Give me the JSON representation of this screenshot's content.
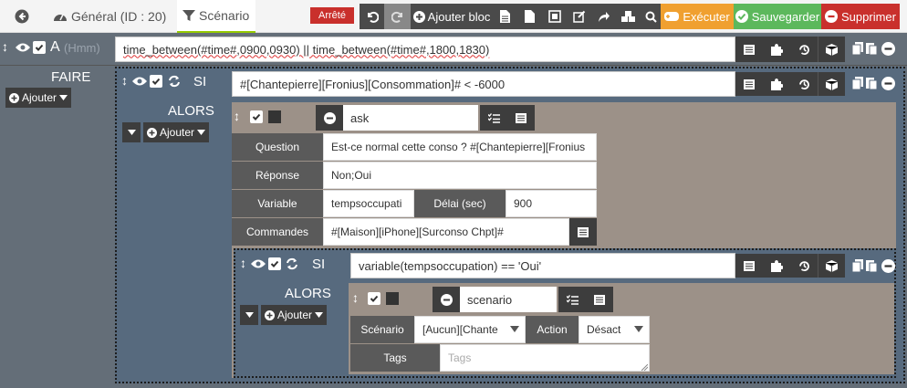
{
  "nav": {
    "general_label": "Général (ID : 20)",
    "scenario_label": "Scénario",
    "status": "Arrêté",
    "add_block_label": "Ajouter bloc",
    "execute_label": "Exécuter",
    "save_label": "Sauvegarder",
    "delete_label": "Supprimer"
  },
  "colors": {
    "status_red": "#c9302c",
    "execute_orange": "#f0a030",
    "save_green": "#5cb85c",
    "delete_red": "#c9302c",
    "main_bg": "#646e78",
    "block_bg": "#9c9188",
    "nested_bg": "#576a7e"
  },
  "block_a": {
    "letter": "A",
    "hint": "(Hmm)",
    "condition": "time_between(#time#,0900,0930) || time_between(#time#,1800,1830)",
    "faire_label": "FAIRE",
    "add_label": "Ajouter"
  },
  "si_block": {
    "si_label": "SI",
    "condition": "#[Chantepierre][Fronius][Consommation]# < -6000",
    "alors_label": "ALORS",
    "add_label": "Ajouter"
  },
  "ask_action": {
    "name": "ask",
    "question_label": "Question",
    "question_value": "Est-ce normal cette conso ? #[Chantepierre][Fronius",
    "reponse_label": "Réponse",
    "reponse_value": "Non;Oui",
    "variable_label": "Variable",
    "variable_value": "tempsoccupati",
    "delai_label": "Délai (sec)",
    "delai_value": "900",
    "commandes_label": "Commandes",
    "commandes_value": "#[Maison][iPhone][Surconso Chpt]#"
  },
  "si_block_2": {
    "si_label": "SI",
    "condition": "variable(tempsoccupation) == 'Oui'",
    "alors_label": "ALORS",
    "add_label": "Ajouter"
  },
  "scenario_action": {
    "name": "scenario",
    "scenario_label": "Scénario",
    "scenario_value": "[Aucun][Chante",
    "action_label": "Action",
    "action_value": "Désact",
    "tags_label": "Tags",
    "tags_placeholder": "Tags"
  }
}
